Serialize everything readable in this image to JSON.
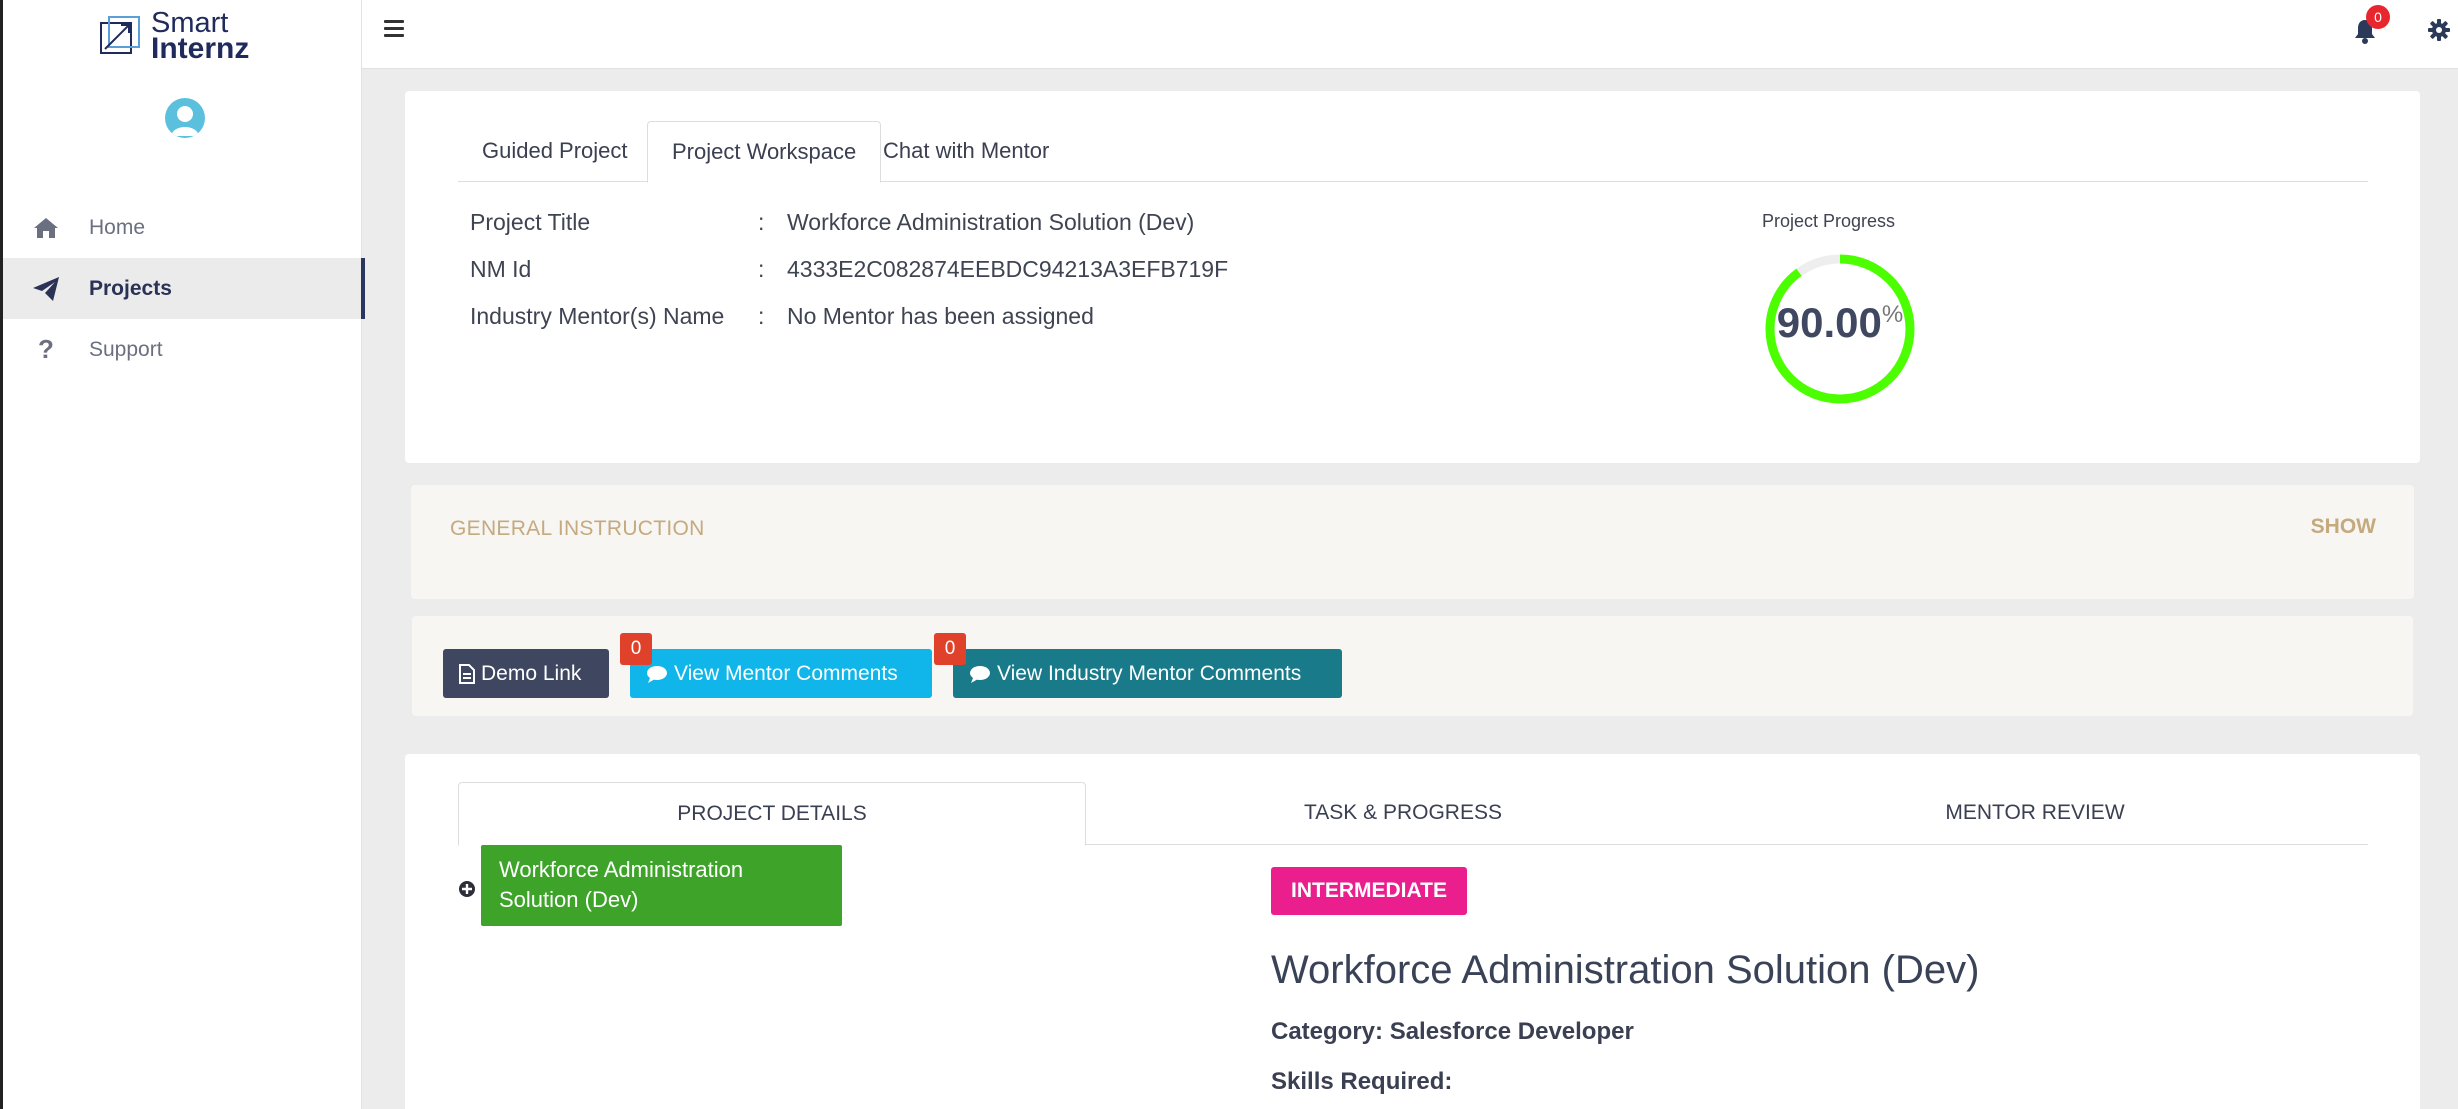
{
  "brand": {
    "line1": "Smart",
    "line2": "Internz"
  },
  "sidebar": {
    "items": [
      {
        "label": "Home",
        "icon": "home-icon"
      },
      {
        "label": "Projects",
        "icon": "paper-plane-icon",
        "active": true
      },
      {
        "label": "Support",
        "icon": "question-icon"
      }
    ]
  },
  "header": {
    "notification_count": "0"
  },
  "workspace": {
    "tabs": [
      "Guided Project",
      "Project Workspace",
      "Chat with Mentor"
    ],
    "active_tab": "Project Workspace",
    "info": [
      {
        "key": "Project Title",
        "sep": ":",
        "value": "Workforce Administration Solution (Dev)"
      },
      {
        "key": "NM Id",
        "sep": ":",
        "value": "4333E2C082874EEBDC94213A3EFB719F"
      },
      {
        "key": "Industry Mentor(s) Name",
        "sep": ":",
        "value": "No Mentor has been assigned"
      }
    ],
    "progress": {
      "label": "Project Progress",
      "value": "90.00",
      "unit": "%",
      "fraction": 0.9
    }
  },
  "instruction": {
    "title": "GENERAL INSTRUCTION",
    "toggle": "SHOW"
  },
  "actions": {
    "demo_link": "Demo Link",
    "view_mentor_comments": "View Mentor Comments",
    "mentor_comments_count": "0",
    "view_industry_mentor_comments": "View Industry Mentor Comments",
    "industry_comments_count": "0"
  },
  "details": {
    "tabs": [
      "PROJECT DETAILS",
      "TASK & PROGRESS",
      "MENTOR REVIEW"
    ],
    "active_tab": "PROJECT DETAILS",
    "tree_item": "Workforce Administration Solution (Dev)",
    "level": "INTERMEDIATE",
    "title": "Workforce Administration Solution (Dev)",
    "category": "Category: Salesforce Developer",
    "skills": "Skills Required:"
  },
  "colors": {
    "progress_ring": "#4cff00",
    "level_badge": "#ea1e8d",
    "tree_item": "#3da329",
    "btn_demo": "#3e4660",
    "btn_mentor": "#10b5ea",
    "btn_industry": "#197a8a"
  }
}
